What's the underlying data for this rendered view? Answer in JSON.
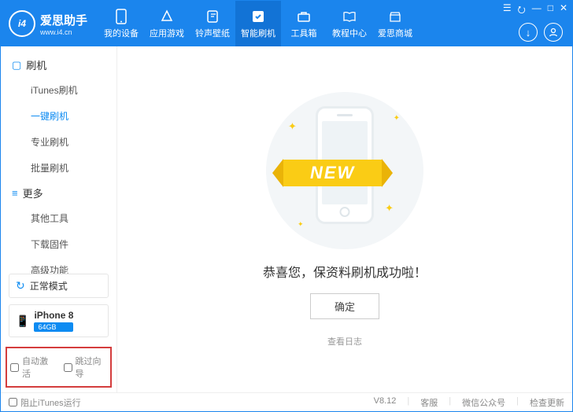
{
  "brand": {
    "name": "爱思助手",
    "mark": "i4",
    "url": "www.i4.cn"
  },
  "window_btns": [
    "☰",
    "⭮",
    "—",
    "□",
    "✕"
  ],
  "tabs": [
    {
      "id": "device",
      "label": "我的设备"
    },
    {
      "id": "apps",
      "label": "应用游戏"
    },
    {
      "id": "ring",
      "label": "铃声壁纸"
    },
    {
      "id": "flash",
      "label": "智能刷机",
      "active": true
    },
    {
      "id": "toolbox",
      "label": "工具箱"
    },
    {
      "id": "tutorial",
      "label": "教程中心"
    },
    {
      "id": "mall",
      "label": "爱思商城"
    }
  ],
  "header_btns": {
    "download": "↓",
    "user": "👤"
  },
  "sidebar": {
    "sections": [
      {
        "title": "刷机",
        "items": [
          {
            "label": "iTunes刷机"
          },
          {
            "label": "一键刷机",
            "active": true
          },
          {
            "label": "专业刷机"
          },
          {
            "label": "批量刷机"
          }
        ]
      },
      {
        "title": "更多",
        "items": [
          {
            "label": "其他工具"
          },
          {
            "label": "下载固件"
          },
          {
            "label": "高级功能"
          }
        ]
      }
    ],
    "mode": {
      "icon": "↻",
      "label": "正常模式"
    },
    "device": {
      "icon": "📱",
      "name": "iPhone 8",
      "storage": "64GB"
    },
    "options": [
      {
        "label": "自动激活",
        "checked": false
      },
      {
        "label": "跳过向导",
        "checked": false
      }
    ]
  },
  "main": {
    "ribbon": "NEW",
    "message": "恭喜您，保资料刷机成功啦！",
    "ok": "确定",
    "log": "查看日志"
  },
  "footer": {
    "block_itunes": "阻止iTunes运行",
    "version": "V8.12",
    "links": [
      "客服",
      "微信公众号",
      "检查更新"
    ]
  }
}
